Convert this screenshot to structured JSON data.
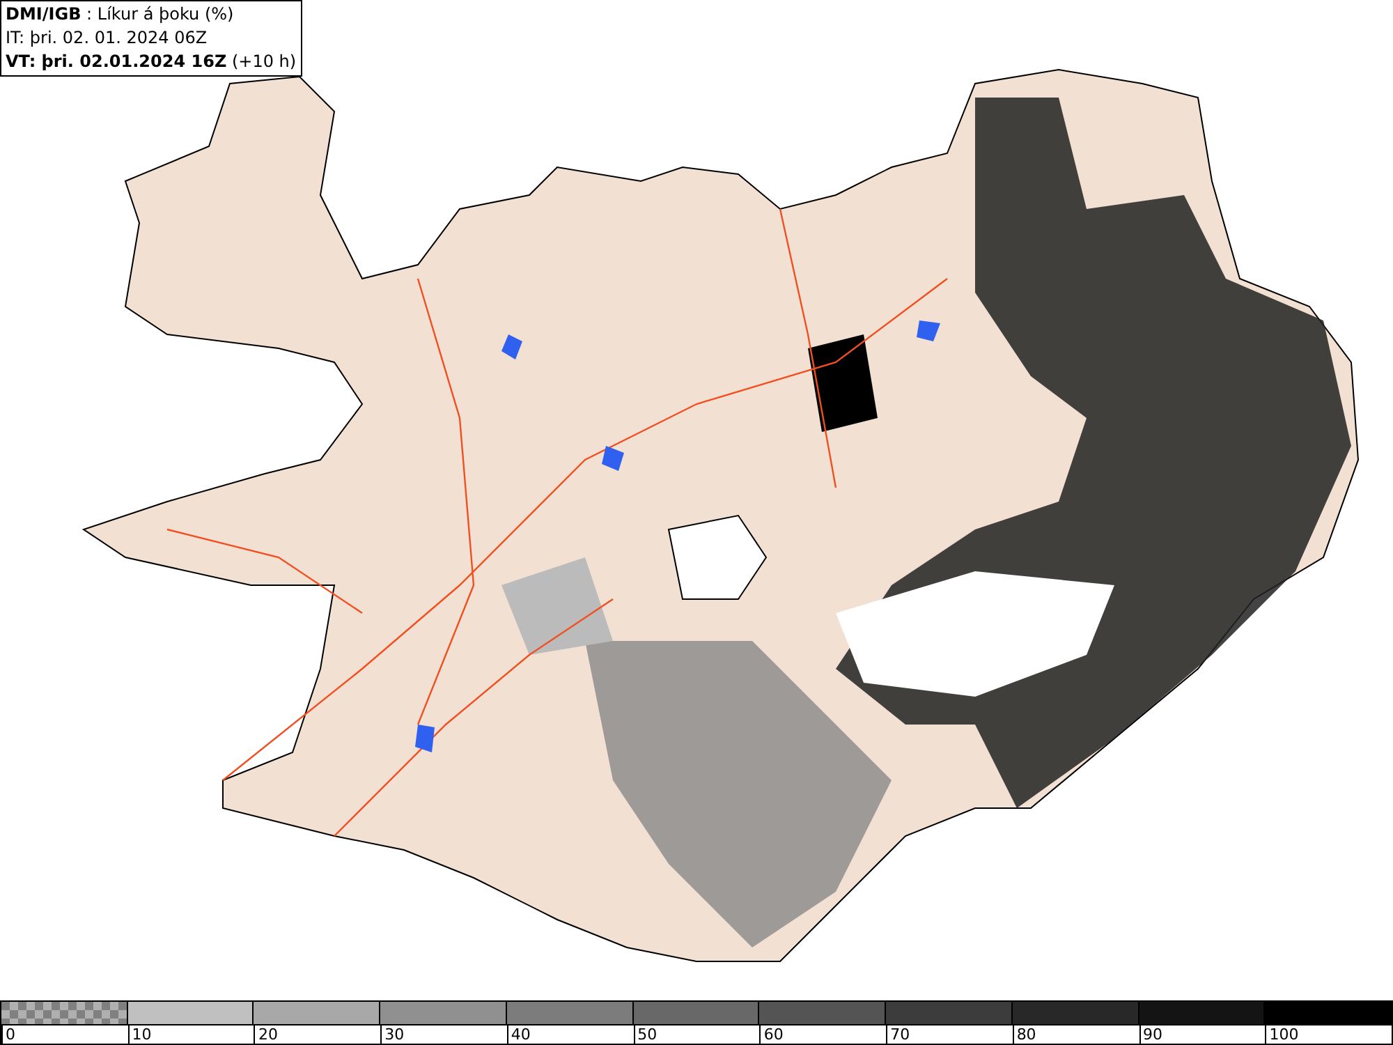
{
  "title_box": {
    "lines": [
      "**DMI/IGB** : Líkur á þoku (%)",
      "IT: þri. 02. 01. 2024 06Z",
      "**VT: þri. 02.01.2024 16Z** (+10 h)"
    ]
  },
  "legend": {
    "items": [
      {
        "label": "0",
        "kind": "checker",
        "color": "#808080"
      },
      {
        "label": "10",
        "kind": "solid",
        "color": "#c0c0c0"
      },
      {
        "label": "20",
        "kind": "solid",
        "color": "#a8a8a8"
      },
      {
        "label": "30",
        "kind": "solid",
        "color": "#909090"
      },
      {
        "label": "40",
        "kind": "solid",
        "color": "#7c7c7c"
      },
      {
        "label": "50",
        "kind": "solid",
        "color": "#686868"
      },
      {
        "label": "60",
        "kind": "solid",
        "color": "#545454"
      },
      {
        "label": "70",
        "kind": "solid",
        "color": "#3c3c3c"
      },
      {
        "label": "80",
        "kind": "solid",
        "color": "#282828"
      },
      {
        "label": "90",
        "kind": "solid",
        "color": "#141414"
      },
      {
        "label": "100",
        "kind": "solid",
        "color": "#000000"
      }
    ]
  }
}
